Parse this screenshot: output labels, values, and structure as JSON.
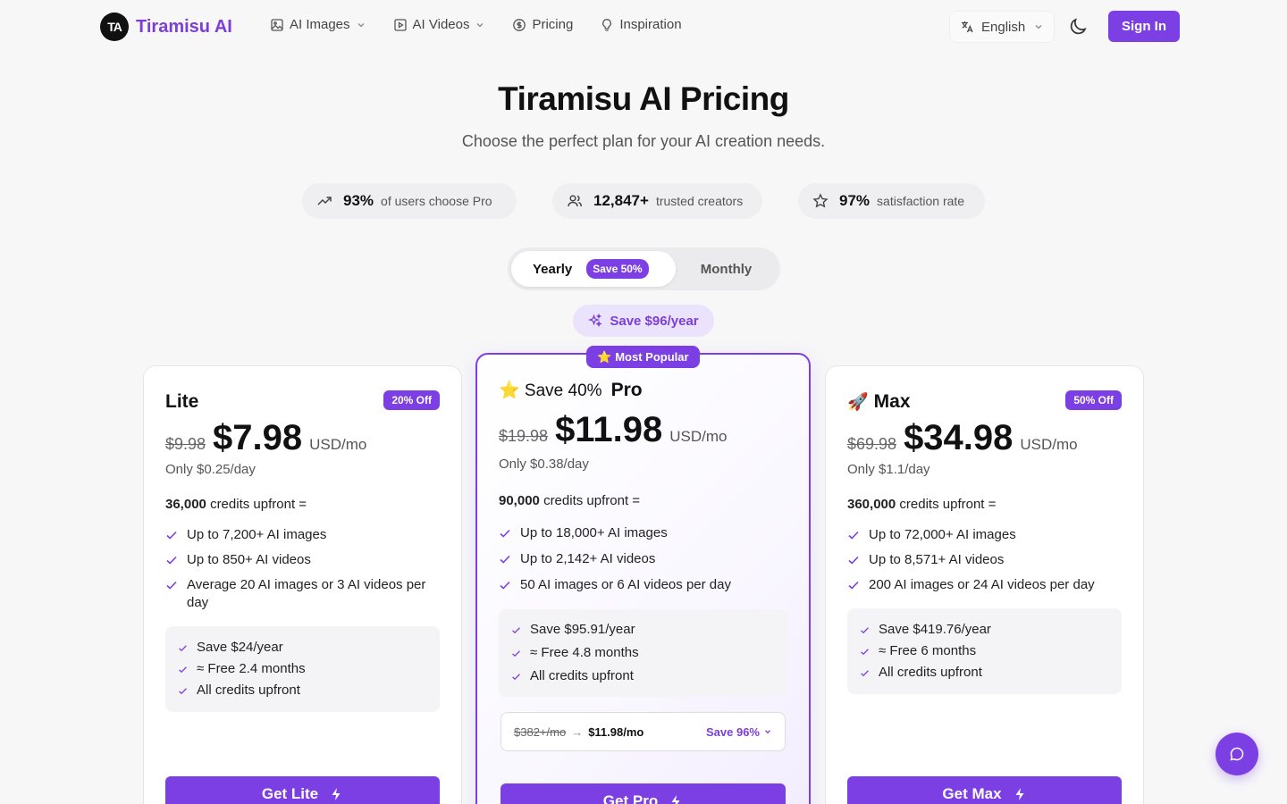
{
  "nav": {
    "logo_text": "Tiramisu AI",
    "links": [
      {
        "label": "AI Images",
        "icon": "image-icon",
        "dropdown": true
      },
      {
        "label": "AI Videos",
        "icon": "video-icon",
        "dropdown": true
      },
      {
        "label": "Pricing",
        "icon": "dollar-circle-icon",
        "dropdown": false
      },
      {
        "label": "Inspiration",
        "icon": "lightbulb-icon",
        "dropdown": false
      }
    ],
    "language": "English",
    "signin_label": "Sign In"
  },
  "header": {
    "title": "Tiramisu AI Pricing",
    "subtitle": "Choose the perfect plan for your AI creation needs."
  },
  "stats": [
    {
      "value": "93%",
      "label": "of users choose Pro",
      "icon": "trending-up-icon"
    },
    {
      "value": "12,847+",
      "label": "trusted creators",
      "icon": "users-icon"
    },
    {
      "value": "97%",
      "label": "satisfaction rate",
      "icon": "star-icon"
    }
  ],
  "billing": {
    "yearly_label": "Yearly",
    "yearly_badge": "Save 50%",
    "monthly_label": "Monthly",
    "selected": "Yearly"
  },
  "save_year": "Save $96/year",
  "popular_badge": "⭐ Most Popular",
  "plans": {
    "lite": {
      "name": "Lite",
      "off_badge": "20% Off",
      "old_price": "$9.98",
      "price": "$7.98",
      "unit": "USD/mo",
      "per_day": "Only $0.25/day",
      "credits_amount": "36,000",
      "credits_suffix": "credits upfront =",
      "features": [
        "Up to 7,200+ AI images",
        "Up to 850+ AI videos",
        "Average 20 AI images or 3 AI videos per day"
      ],
      "perks": [
        "Save $24/year",
        "≈ Free 2.4 months",
        "All credits upfront"
      ],
      "cta": "Get Lite"
    },
    "pro": {
      "prefix": "⭐ Save 40%",
      "name": "Pro",
      "old_price": "$19.98",
      "price": "$11.98",
      "unit": "USD/mo",
      "per_day": "Only $0.38/day",
      "credits_amount": "90,000",
      "credits_suffix": "credits upfront =",
      "features": [
        "Up to 18,000+ AI images",
        "Up to 2,142+ AI videos",
        "50 AI images or 6 AI videos per day"
      ],
      "perks": [
        "Save $95.91/year",
        "≈ Free 4.8 months",
        "All credits upfront"
      ],
      "compare_old": "$382+/mo",
      "compare_arrow": "→",
      "compare_new": "$11.98/mo",
      "compare_save": "Save 96%",
      "cta": "Get Pro"
    },
    "max": {
      "prefix": "🚀",
      "name": "Max",
      "off_badge": "50% Off",
      "old_price": "$69.98",
      "price": "$34.98",
      "unit": "USD/mo",
      "per_day": "Only $1.1/day",
      "credits_amount": "360,000",
      "credits_suffix": "credits upfront =",
      "features": [
        "Up to 72,000+ AI images",
        "Up to 8,571+ AI videos",
        "200 AI images or 24 AI videos per day"
      ],
      "perks": [
        "Save $419.76/year",
        "≈ Free 6 months",
        "All credits upfront"
      ],
      "cta": "Get Max"
    }
  },
  "colors": {
    "accent": "#7c3fe4",
    "background": "#f7f7f8"
  }
}
